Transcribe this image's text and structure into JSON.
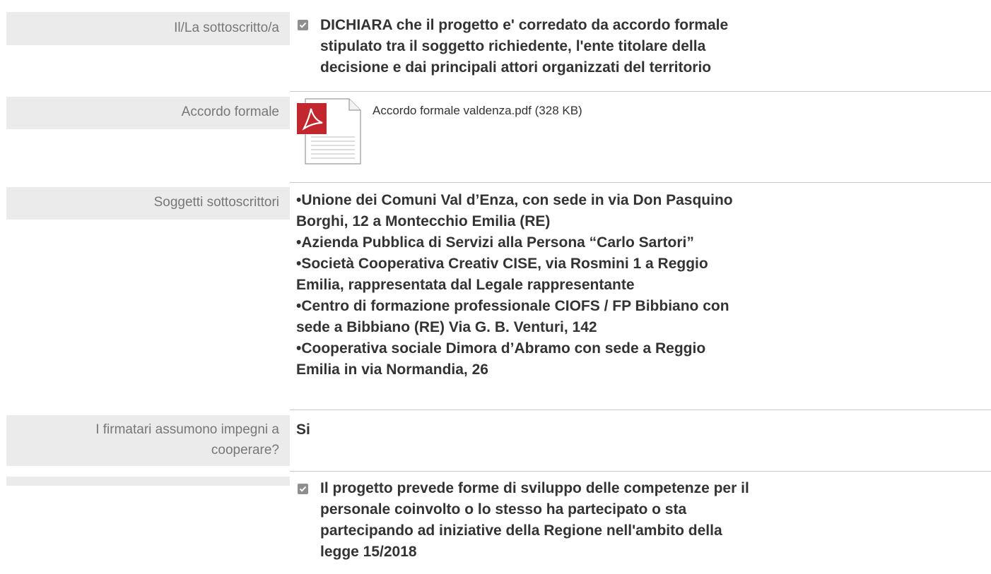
{
  "rows": [
    {
      "label": "Il/La sottoscritto/a",
      "declaration_text": "DICHIARA che il progetto e' corredato da accordo formale stipulato tra il soggetto richiedente, l'ente titolare della decisione e dai principali attori organizzati del territorio",
      "checked": true
    },
    {
      "label": "Accordo formale",
      "file": {
        "name": "Accordo formale valdenza.pdf (328 KB)",
        "icon": "pdf-file-icon"
      }
    },
    {
      "label": "Soggetti sottoscrittori",
      "lines": [
        "•Unione dei Comuni Val d’Enza, con sede in via Don Pasquino",
        "Borghi, 12 a Montecchio Emilia (RE)",
        "•Azienda Pubblica di Servizi alla Persona “Carlo Sartori”",
        "•Società Cooperativa Creativ CISE, via Rosmini 1 a Reggio",
        "Emilia, rappresentata dal Legale rappresentante",
        "•Centro di formazione professionale CIOFS / FP Bibbiano con",
        "sede a Bibbiano (RE) Via G. B. Venturi, 142",
        "•Cooperativa sociale Dimora d’Abramo con sede a Reggio",
        "Emilia in via Normandia, 26"
      ]
    },
    {
      "label_lines": [
        "I firmatari assumono impegni a",
        "cooperare?"
      ],
      "value": "Si"
    },
    {
      "label": "",
      "declaration_lines": [
        "Il progetto prevede forme di sviluppo delle competenze per il",
        "personale coinvolto o lo stesso ha partecipato o sta",
        "partecipando ad iniziative della Regione nell'ambito della",
        "legge 15/2018"
      ],
      "checked": true
    }
  ],
  "declaration_lines_row0": [
    "DICHIARA che il progetto e' corredato da accordo formale",
    "stipulato tra il soggetto richiedente, l'ente titolare della",
    "decisione e dai principali attori organizzati del territorio"
  ],
  "colors": {
    "label_bg": "#ebebeb",
    "label_text": "#777777",
    "value_text": "#333333",
    "checkbox": "#8f8f8f",
    "pdf_red": "#c1272d"
  }
}
